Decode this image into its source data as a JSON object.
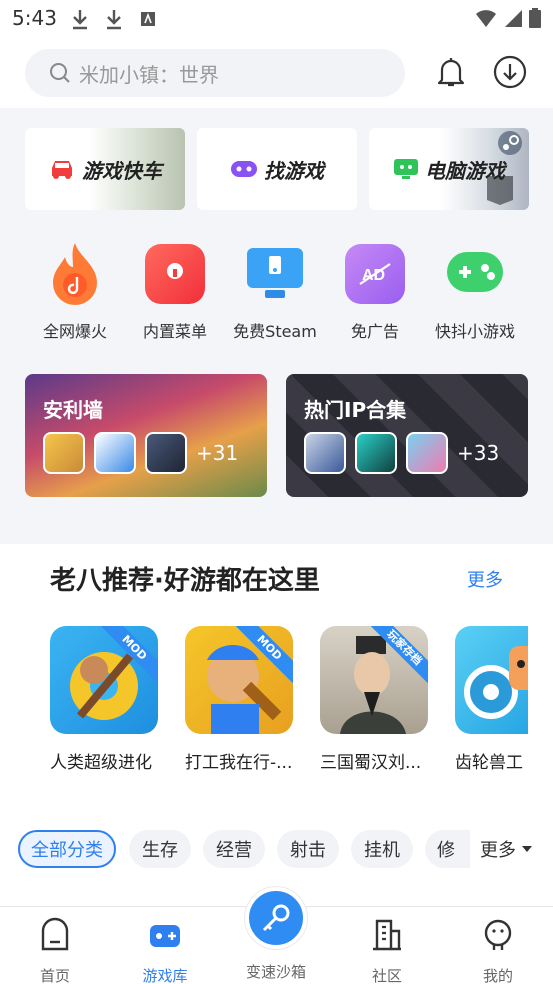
{
  "status": {
    "time": "5:43"
  },
  "search": {
    "placeholder": "米加小镇：世界"
  },
  "quick_cards": [
    {
      "label": "游戏快车"
    },
    {
      "label": "找游戏"
    },
    {
      "label": "电脑游戏"
    }
  ],
  "features": [
    {
      "label": "全网爆火",
      "icon": "flame-icon"
    },
    {
      "label": "内置菜单",
      "icon": "menu-icon"
    },
    {
      "label": "免费Steam",
      "icon": "monitor-icon"
    },
    {
      "label": "免广告",
      "icon": "ad-free-icon"
    },
    {
      "label": "快抖小游戏",
      "icon": "gamepad-icon"
    }
  ],
  "banners": [
    {
      "title": "安利墙",
      "count": "+31"
    },
    {
      "title": "热门IP合集",
      "count": "+33"
    }
  ],
  "section": {
    "title": "老八推荐·好游都在这里",
    "more": "更多"
  },
  "games": [
    {
      "name": "人类超级进化",
      "tag": "MOD"
    },
    {
      "name": "打工我在行-...",
      "tag": "MOD"
    },
    {
      "name": "三国蜀汉刘...",
      "tag": "玩家存档"
    },
    {
      "name": "齿轮兽工",
      "tag": ""
    }
  ],
  "categories": [
    {
      "label": "全部分类"
    },
    {
      "label": "生存"
    },
    {
      "label": "经营"
    },
    {
      "label": "射击"
    },
    {
      "label": "挂机"
    },
    {
      "label": "修"
    }
  ],
  "categories_more": "更多",
  "nav": [
    {
      "label": "首页"
    },
    {
      "label": "游戏库"
    },
    {
      "label": "变速沙箱"
    },
    {
      "label": "社区"
    },
    {
      "label": "我的"
    }
  ],
  "colors": {
    "accent": "#2f7ff0",
    "background_gray": "#f4f5f8"
  }
}
